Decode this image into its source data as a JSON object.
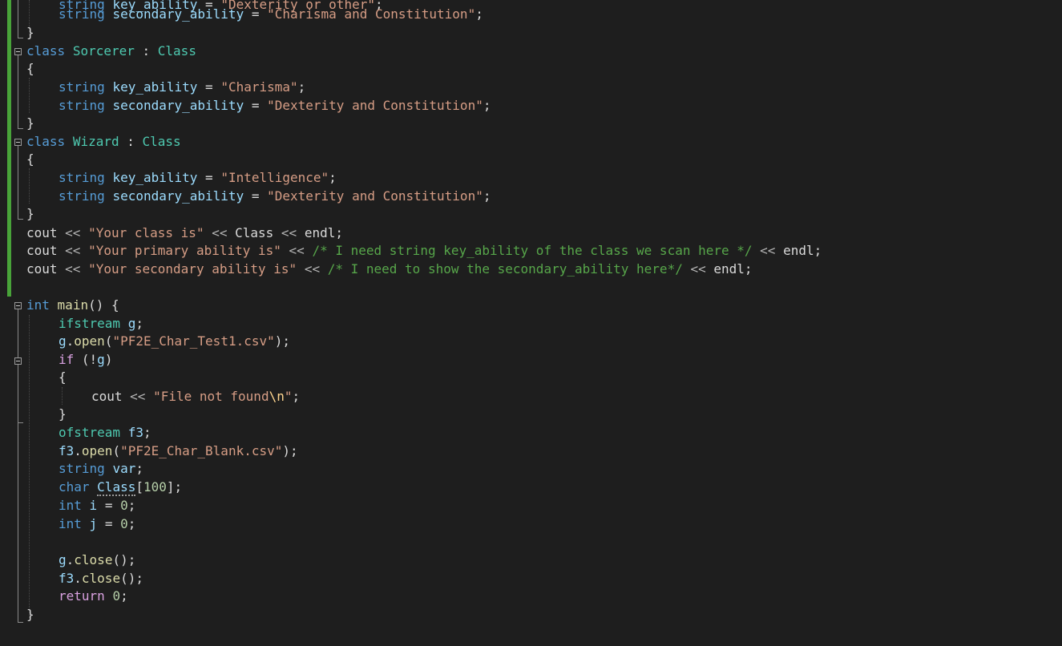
{
  "editor": {
    "language": "C++",
    "theme": "dark",
    "colors": {
      "background": "#1e1e1e",
      "keyword": "#569cd6",
      "control": "#d8a0df",
      "type": "#4ec9b0",
      "variable": "#9cdcfe",
      "function": "#dcdcaa",
      "string": "#d69d85",
      "comment": "#57a64a",
      "number": "#b5cea8",
      "change_indicator": "#48a339"
    },
    "lines": [
      [
        [
          "kw",
          "string"
        ],
        [
          "p",
          " "
        ],
        [
          "var",
          "key_ability"
        ],
        [
          "p",
          " = "
        ],
        [
          "str",
          "\"Dexterity or other\""
        ],
        [
          "p",
          ";"
        ]
      ],
      [
        [
          "kw",
          "string"
        ],
        [
          "p",
          " "
        ],
        [
          "var",
          "secondary_ability"
        ],
        [
          "p",
          " = "
        ],
        [
          "str",
          "\"Charisma and Constitution\""
        ],
        [
          "p",
          ";"
        ]
      ],
      [
        [
          "p",
          "}"
        ]
      ],
      [
        [
          "kw",
          "class"
        ],
        [
          "p",
          " "
        ],
        [
          "typ",
          "Sorcerer"
        ],
        [
          "p",
          " : "
        ],
        [
          "typ",
          "Class"
        ]
      ],
      [
        [
          "p",
          "{"
        ]
      ],
      [
        [
          "kw",
          "string"
        ],
        [
          "p",
          " "
        ],
        [
          "var",
          "key_ability"
        ],
        [
          "p",
          " = "
        ],
        [
          "str",
          "\"Charisma\""
        ],
        [
          "p",
          ";"
        ]
      ],
      [
        [
          "kw",
          "string"
        ],
        [
          "p",
          " "
        ],
        [
          "var",
          "secondary_ability"
        ],
        [
          "p",
          " = "
        ],
        [
          "str",
          "\"Dexterity and Constitution\""
        ],
        [
          "p",
          ";"
        ]
      ],
      [
        [
          "p",
          "}"
        ]
      ],
      [
        [
          "kw",
          "class"
        ],
        [
          "p",
          " "
        ],
        [
          "typ",
          "Wizard"
        ],
        [
          "p",
          " : "
        ],
        [
          "typ",
          "Class"
        ]
      ],
      [
        [
          "p",
          "{"
        ]
      ],
      [
        [
          "kw",
          "string"
        ],
        [
          "p",
          " "
        ],
        [
          "var",
          "key_ability"
        ],
        [
          "p",
          " = "
        ],
        [
          "str",
          "\"Intelligence\""
        ],
        [
          "p",
          ";"
        ]
      ],
      [
        [
          "kw",
          "string"
        ],
        [
          "p",
          " "
        ],
        [
          "var",
          "secondary_ability"
        ],
        [
          "p",
          " = "
        ],
        [
          "str",
          "\"Dexterity and Constitution\""
        ],
        [
          "p",
          ";"
        ]
      ],
      [
        [
          "p",
          "}"
        ]
      ],
      [
        [
          "p",
          "cout "
        ],
        [
          "op",
          "<<"
        ],
        [
          "p",
          " "
        ],
        [
          "str",
          "\"Your class is\""
        ],
        [
          "p",
          " "
        ],
        [
          "op",
          "<<"
        ],
        [
          "p",
          " Class "
        ],
        [
          "op",
          "<<"
        ],
        [
          "p",
          " endl;"
        ]
      ],
      [
        [
          "p",
          "cout "
        ],
        [
          "op",
          "<<"
        ],
        [
          "p",
          " "
        ],
        [
          "str",
          "\"Your primary ability is\""
        ],
        [
          "p",
          " "
        ],
        [
          "op",
          "<<"
        ],
        [
          "p",
          " "
        ],
        [
          "cmt",
          "/* I need string key_ability of the class we scan here */"
        ],
        [
          "p",
          " "
        ],
        [
          "op",
          "<<"
        ],
        [
          "p",
          " endl;"
        ]
      ],
      [
        [
          "p",
          "cout "
        ],
        [
          "op",
          "<<"
        ],
        [
          "p",
          " "
        ],
        [
          "str",
          "\"Your secondary ability is\""
        ],
        [
          "p",
          " "
        ],
        [
          "op",
          "<<"
        ],
        [
          "p",
          " "
        ],
        [
          "cmt",
          "/* I need to show the secondary_ability here*/"
        ],
        [
          "p",
          " "
        ],
        [
          "op",
          "<<"
        ],
        [
          "p",
          " endl;"
        ]
      ],
      [],
      [
        [
          "kw",
          "int"
        ],
        [
          "p",
          " "
        ],
        [
          "fn",
          "main"
        ],
        [
          "p",
          "() {"
        ]
      ],
      [
        [
          "typ",
          "ifstream"
        ],
        [
          "p",
          " "
        ],
        [
          "var",
          "g"
        ],
        [
          "p",
          ";"
        ]
      ],
      [
        [
          "var",
          "g"
        ],
        [
          "p",
          "."
        ],
        [
          "fn",
          "open"
        ],
        [
          "p",
          "("
        ],
        [
          "str",
          "\"PF2E_Char_Test1.csv\""
        ],
        [
          "p",
          ");"
        ]
      ],
      [
        [
          "ctl",
          "if"
        ],
        [
          "p",
          " (!"
        ],
        [
          "var",
          "g"
        ],
        [
          "p",
          ")"
        ]
      ],
      [
        [
          "p",
          "{"
        ]
      ],
      [
        [
          "p",
          "cout "
        ],
        [
          "op",
          "<<"
        ],
        [
          "p",
          " "
        ],
        [
          "str",
          "\"File not found"
        ],
        [
          "esc",
          "\\n"
        ],
        [
          "str",
          "\""
        ],
        [
          "p",
          ";"
        ]
      ],
      [
        [
          "p",
          "}"
        ]
      ],
      [
        [
          "typ",
          "ofstream"
        ],
        [
          "p",
          " "
        ],
        [
          "var",
          "f3"
        ],
        [
          "p",
          ";"
        ]
      ],
      [
        [
          "var",
          "f3"
        ],
        [
          "p",
          "."
        ],
        [
          "fn",
          "open"
        ],
        [
          "p",
          "("
        ],
        [
          "str",
          "\"PF2E_Char_Blank.csv\""
        ],
        [
          "p",
          ");"
        ]
      ],
      [
        [
          "kw",
          "string"
        ],
        [
          "p",
          " "
        ],
        [
          "var",
          "var"
        ],
        [
          "p",
          ";"
        ]
      ],
      [
        [
          "kw",
          "char"
        ],
        [
          "p",
          " "
        ],
        [
          "var",
          "Class"
        ],
        [
          "p",
          "["
        ],
        [
          "num",
          "100"
        ],
        [
          "p",
          "];"
        ]
      ],
      [
        [
          "kw",
          "int"
        ],
        [
          "p",
          " "
        ],
        [
          "var",
          "i"
        ],
        [
          "p",
          " = "
        ],
        [
          "num",
          "0"
        ],
        [
          "p",
          ";"
        ]
      ],
      [
        [
          "kw",
          "int"
        ],
        [
          "p",
          " "
        ],
        [
          "var",
          "j"
        ],
        [
          "p",
          " = "
        ],
        [
          "num",
          "0"
        ],
        [
          "p",
          ";"
        ]
      ],
      [],
      [
        [
          "var",
          "g"
        ],
        [
          "p",
          "."
        ],
        [
          "fn",
          "close"
        ],
        [
          "p",
          "();"
        ]
      ],
      [
        [
          "var",
          "f3"
        ],
        [
          "p",
          "."
        ],
        [
          "fn",
          "close"
        ],
        [
          "p",
          "();"
        ]
      ],
      [
        [
          "ctl",
          "return"
        ],
        [
          "p",
          " "
        ],
        [
          "num",
          "0"
        ],
        [
          "p",
          ";"
        ]
      ],
      [
        [
          "p",
          "}"
        ]
      ]
    ]
  }
}
